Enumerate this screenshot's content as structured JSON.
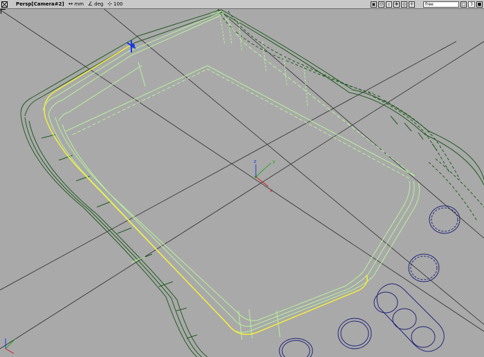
{
  "window": {
    "title": "Persp[Camera#2]",
    "linear_unit": "mm",
    "angle_unit": "deg",
    "grid_value": "100",
    "view_mode": "free",
    "layout_count": "3"
  },
  "toolbar_icons": [
    "camera-icon",
    "dolly-icon",
    "zoom-icon",
    "tumble-icon",
    "frame-icon",
    "pan-icon"
  ],
  "colors": {
    "background": "#a9a9a9",
    "wire_green_dark": "#1f5a1f",
    "wire_green_light": "#b7f39a",
    "curve_yellow": "#f5ef3a",
    "circle_blue": "#23237a",
    "grid_line": "#2a2a2a",
    "axis_x": "#d62020",
    "axis_y": "#22a822",
    "axis_z": "#1a3ae0"
  },
  "axis_labels": {
    "x": "x",
    "y": "y",
    "z": "z"
  }
}
